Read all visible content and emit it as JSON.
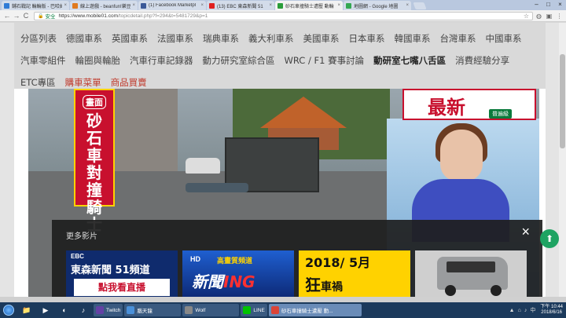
{
  "browser": {
    "tabs": [
      {
        "label": "鋪石戰記 輪輪版 - 巴哈姆",
        "color": "#2f7bd6"
      },
      {
        "label": "線上遊戲 - beanfun!樂豆",
        "color": "#e07a1f"
      },
      {
        "label": "(1) Facebook Marketpl",
        "color": "#3b5998"
      },
      {
        "label": "(13) EBC 東森新聞 51",
        "color": "#e02020"
      },
      {
        "label": "砂石車撞騎士遭壓 動輪「萬",
        "color": "#2a9d3a"
      },
      {
        "label": "地圖網 - Google 地圖",
        "color": "#34a853"
      }
    ],
    "active_tab_index": 4,
    "tab_close": "×",
    "window_controls": [
      "–",
      "□",
      "×"
    ],
    "nav": {
      "back": "←",
      "forward": "→",
      "reload": "C"
    },
    "address": {
      "secure_label": "安全",
      "lock": "🔒",
      "host": "https://www.mobile01.com",
      "path": "/topicdetail.php?f=294&t=5481729&p=1"
    },
    "star": "☆",
    "extensions": [
      "◍",
      "▣",
      "⋮"
    ]
  },
  "page": {
    "categories_row1": [
      "分區列表",
      "德國車系",
      "英國車系",
      "法國車系",
      "瑞典車系",
      "義大利車系",
      "美國車系",
      "日本車系",
      "韓國車系",
      "台灣車系",
      "中國車系"
    ],
    "categories_row2": [
      "汽車零組件",
      "輪圈與輪胎",
      "汽車行車記錄器",
      "動力研究室綜合區",
      "WRC / F1 賽事討論",
      "動研室七嘴八舌區",
      "消費經驗分享"
    ],
    "categories_row3": [
      "ETC專區",
      "購車菜單",
      "商品買賣"
    ],
    "video": {
      "banner_tag": "畫面",
      "banner_text": "砂石車對撞騎士",
      "news_big": "最新",
      "news_level": "普遍級"
    },
    "more_videos": {
      "title": "更多影片",
      "close": "×",
      "thumbs": [
        {
          "logo": "EBC",
          "line1": "東森新聞 51頻道",
          "line2": "點我看直播"
        },
        {
          "logo": "HD",
          "channel": "高畫質頻道",
          "headline_a": "新聞",
          "headline_b": "ING"
        },
        {
          "date": "2018/ 5月",
          "headline": "狂",
          "headline_small": "車禍"
        },
        {}
      ]
    },
    "to_top": "⬆"
  },
  "taskbar": {
    "pinned": [
      "📁",
      "▶",
      "◐",
      "♪"
    ],
    "apps": [
      {
        "label": "Twitch",
        "color": "#6441a5"
      },
      {
        "label": "腦天龍",
        "color": "#4a90d9"
      },
      {
        "label": "Wolf",
        "color": "#888888"
      },
      {
        "label": "LINE",
        "color": "#00c300"
      },
      {
        "label": "砂石車撞騎士遭壓 動...",
        "color": "#db4437"
      }
    ],
    "active_app_index": 4,
    "tray": [
      "▲",
      "⌂",
      "♪",
      "中"
    ],
    "time": "下午 10:44",
    "date": "2018/6/16"
  }
}
